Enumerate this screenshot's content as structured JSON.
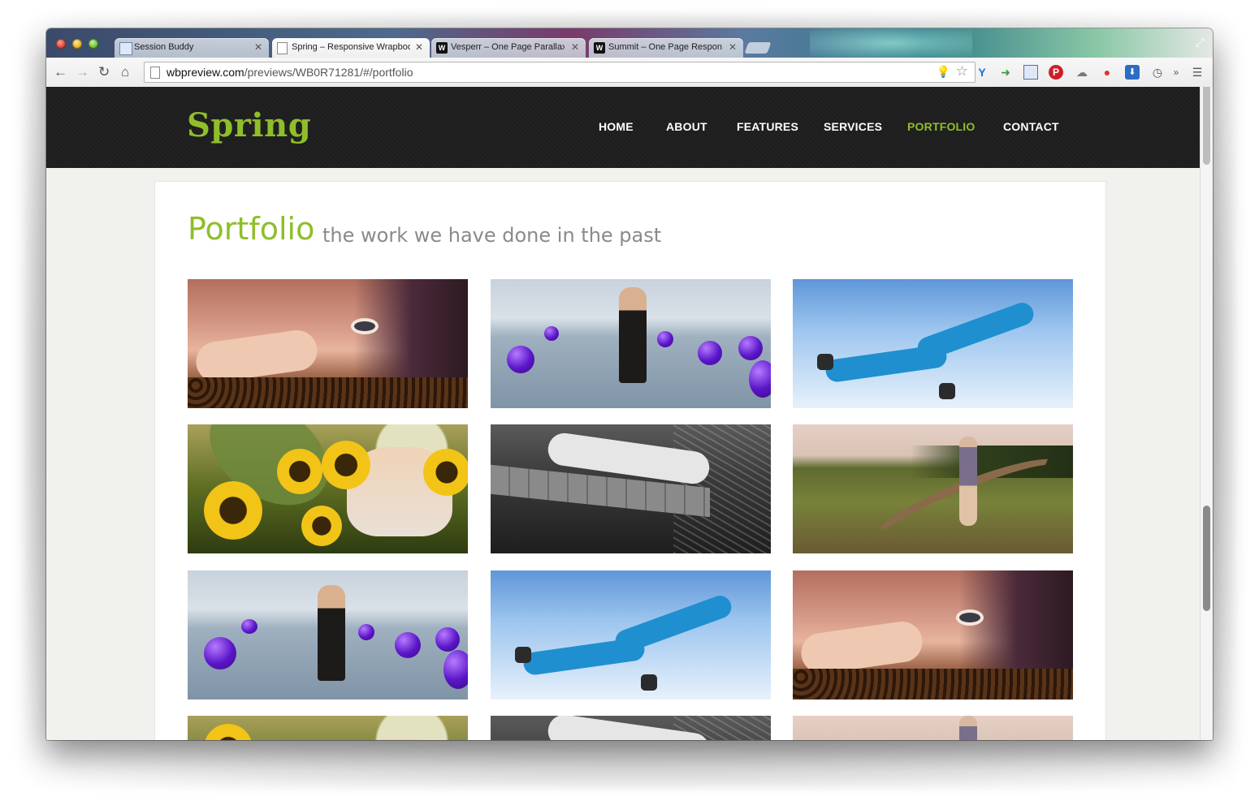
{
  "browser": {
    "tabs": [
      {
        "title": "Session Buddy",
        "favicon": "session-buddy-icon"
      },
      {
        "title": "Spring – Responsive Wrapbootstrap",
        "favicon": "document-icon"
      },
      {
        "title": "Vesperr – One Page Parallax",
        "favicon": "w-logo-icon"
      },
      {
        "title": "Summit – One Page Responsive",
        "favicon": "w-logo-icon"
      }
    ],
    "url_domain": "wbpreview.com",
    "url_path": "/previews/WB0R71281/#/portfolio"
  },
  "site": {
    "logo": "Spring",
    "nav": [
      "HOME",
      "ABOUT",
      "FEATURES",
      "SERVICES",
      "PORTFOLIO",
      "CONTACT"
    ],
    "active_nav": "PORTFOLIO",
    "accent_color": "#8fbe2a"
  },
  "portfolio": {
    "title": "Portfolio",
    "subtitle": "the work we have done in the past",
    "items": [
      {
        "subject": "face on coffee beans"
      },
      {
        "subject": "woman in sea with purple balloons"
      },
      {
        "subject": "snow angel in blue suit"
      },
      {
        "subject": "woman among sunflowers"
      },
      {
        "subject": "black and white woman on dock"
      },
      {
        "subject": "woman on country road"
      },
      {
        "subject": "woman in sea with purple balloons"
      },
      {
        "subject": "snow angel in blue suit"
      },
      {
        "subject": "face on coffee beans"
      },
      {
        "subject": "woman among sunflowers"
      },
      {
        "subject": "black and white woman on dock"
      },
      {
        "subject": "woman on country road"
      }
    ]
  }
}
